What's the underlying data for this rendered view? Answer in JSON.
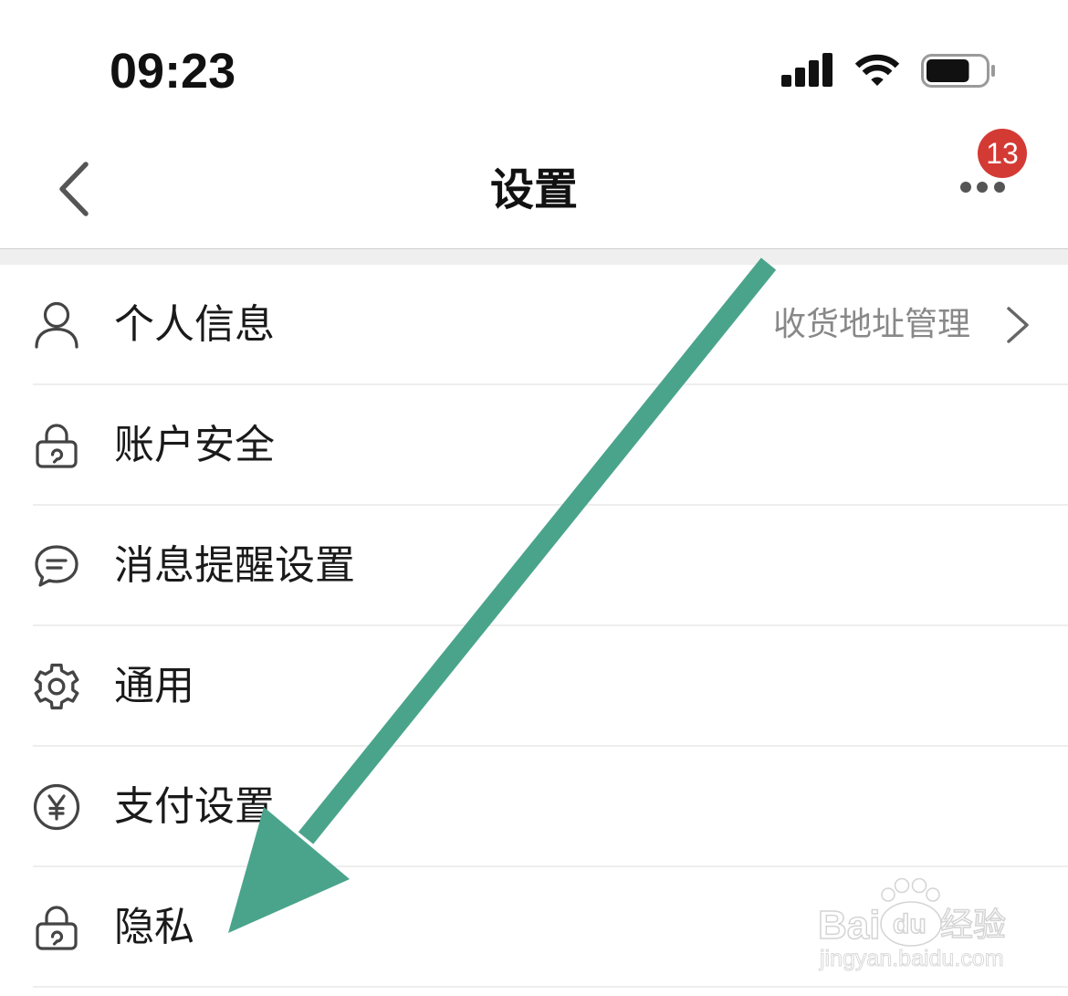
{
  "status_bar": {
    "time": "09:23",
    "signal_icon": "signal-bars-icon",
    "wifi_icon": "wifi-icon",
    "battery_icon": "battery-icon",
    "battery_level_percent": 75
  },
  "nav": {
    "back_icon": "chevron-left-icon",
    "title": "设置",
    "more_icon": "more-dots-icon",
    "badge_count": "13"
  },
  "list": {
    "items": [
      {
        "icon": "person-icon",
        "label": "个人信息",
        "detail": "收货地址管理",
        "trailing_icon": "chevron-right-icon"
      },
      {
        "icon": "lock-icon",
        "label": "账户安全"
      },
      {
        "icon": "chat-bubble-icon",
        "label": "消息提醒设置"
      },
      {
        "icon": "gear-icon",
        "label": "通用"
      },
      {
        "icon": "yen-circle-icon",
        "label": "支付设置"
      },
      {
        "icon": "lock-icon",
        "label": "隐私"
      }
    ]
  },
  "annotation": {
    "arrow_icon": "arrow-down-left-icon"
  },
  "watermark": {
    "logo_left": "Bai",
    "logo_paw": "du",
    "logo_right": "经验",
    "url": "jingyan.baidu.com"
  },
  "colors": {
    "text_primary": "#1a1a1a",
    "text_secondary": "#888888",
    "icon_stroke": "#444444",
    "badge_red": "#d43a34",
    "annotation_arrow": "#4aa48b",
    "divider": "#eeeeee",
    "section_gap": "#efefef"
  }
}
